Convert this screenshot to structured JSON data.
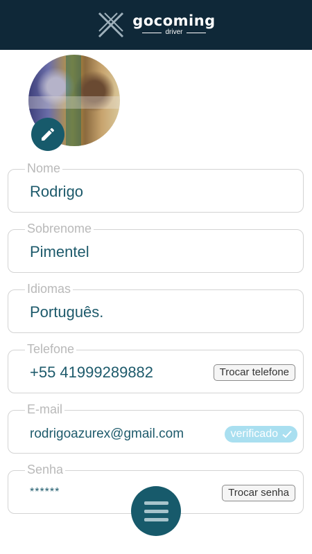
{
  "header": {
    "brand": "gocoming",
    "subtitle": "driver"
  },
  "colors": {
    "header_bg": "#0f2838",
    "accent": "#175a6b",
    "value_text": "#1d5a6b",
    "verified_badge": "#a9dff0"
  },
  "profile": {
    "avatar_icon": "profile-photo",
    "edit_icon": "pencil-icon"
  },
  "fields": {
    "nome": {
      "label": "Nome",
      "value": "Rodrigo"
    },
    "sobrenome": {
      "label": "Sobrenome",
      "value": "Pimentel"
    },
    "idiomas": {
      "label": "Idiomas",
      "value": "Português."
    },
    "telefone": {
      "label": "Telefone",
      "value": "+55 41999289882",
      "button": "Trocar telefone"
    },
    "email": {
      "label": "E-mail",
      "value": "rodrigoazurex@gmail.com",
      "badge": "verificado"
    },
    "senha": {
      "label": "Senha",
      "value": "******",
      "button": "Trocar senha"
    }
  },
  "menu": {
    "icon": "hamburger-menu-icon"
  }
}
